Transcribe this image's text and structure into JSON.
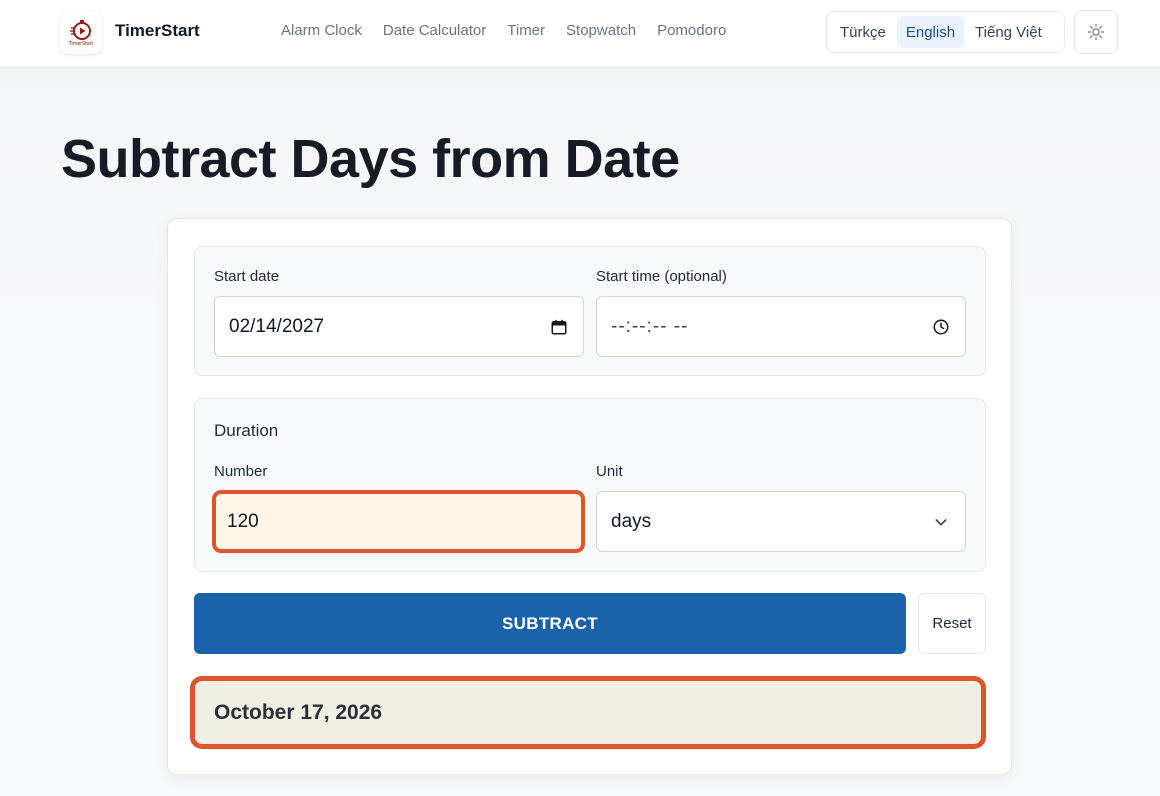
{
  "header": {
    "brand": "TimerStart",
    "logo_text": "TimerStart",
    "nav": [
      "Alarm Clock",
      "Date Calculator",
      "Timer",
      "Stopwatch",
      "Pomodoro"
    ],
    "languages": [
      "Türkçe",
      "English",
      "Tiếng Việt"
    ],
    "active_language": "English",
    "theme_icon": "sun-icon"
  },
  "page": {
    "title": "Subtract Days from Date"
  },
  "form": {
    "start_date_label": "Start date",
    "start_date_value": "02/14/2027",
    "start_time_label": "Start time (optional)",
    "start_time_value": "--:--:-- --",
    "duration_heading": "Duration",
    "number_label": "Number",
    "number_value": "120",
    "unit_label": "Unit",
    "unit_value": "days",
    "submit_label": "SUBTRACT",
    "reset_label": "Reset"
  },
  "result": {
    "text": "October 17, 2026"
  },
  "colors": {
    "primary": "#1a63ab",
    "highlight_border": "#e0532f",
    "highlight_input_bg": "#fdf6e6",
    "result_bg": "#efefe4",
    "active_lang_bg": "#eaf1fb"
  }
}
